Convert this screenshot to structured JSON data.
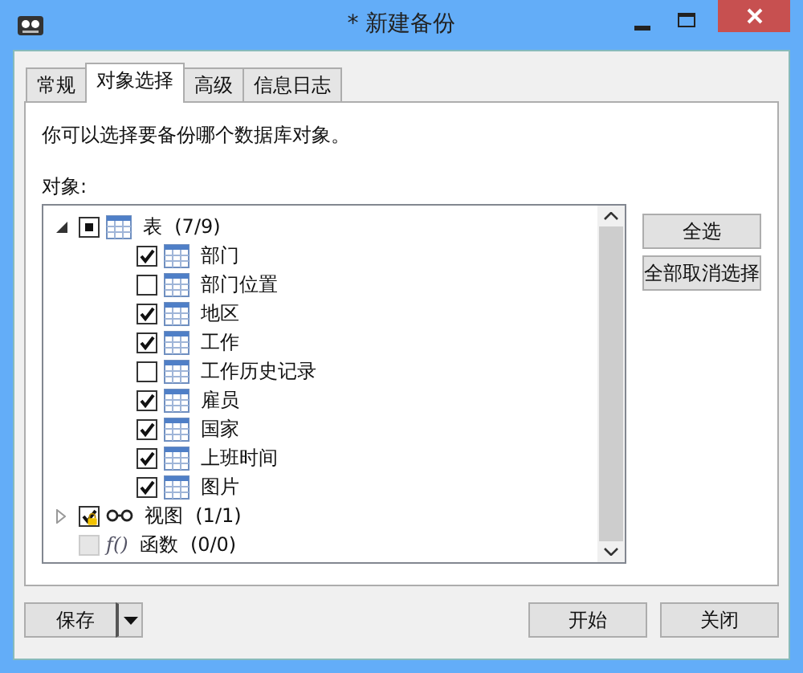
{
  "window": {
    "title": "* 新建备份"
  },
  "tabs": [
    {
      "label": "常规",
      "selected": false
    },
    {
      "label": "对象选择",
      "selected": true
    },
    {
      "label": "高级",
      "selected": false
    },
    {
      "label": "信息日志",
      "selected": false
    }
  ],
  "description": "你可以选择要备份哪个数据库对象。",
  "objects_label": "对象:",
  "tree": [
    {
      "kind": "table",
      "label": "表",
      "count": "(7/9)",
      "mixed": true,
      "expanded": true,
      "children": [
        {
          "kind": "table",
          "label": "部门",
          "checked": true
        },
        {
          "kind": "table",
          "label": "部门位置",
          "checked": false
        },
        {
          "kind": "table",
          "label": "地区",
          "checked": true
        },
        {
          "kind": "table",
          "label": "工作",
          "checked": true
        },
        {
          "kind": "table",
          "label": "工作历史记录",
          "checked": false
        },
        {
          "kind": "table",
          "label": "雇员",
          "checked": true
        },
        {
          "kind": "table",
          "label": "国家",
          "checked": true
        },
        {
          "kind": "table",
          "label": "上班时间",
          "checked": true
        },
        {
          "kind": "table",
          "label": "图片",
          "checked": true
        }
      ]
    },
    {
      "kind": "view",
      "label": "视图",
      "count": "(1/1)",
      "checked": true,
      "locked": true,
      "expanded": false
    },
    {
      "kind": "function",
      "icon": "f()",
      "label": "函数",
      "count": "(0/0)",
      "checked": false,
      "disabled": true
    }
  ],
  "side_buttons": [
    "全选",
    "全部取消选择"
  ],
  "save_button": "保存",
  "buttons": [
    "开始",
    "关闭"
  ]
}
